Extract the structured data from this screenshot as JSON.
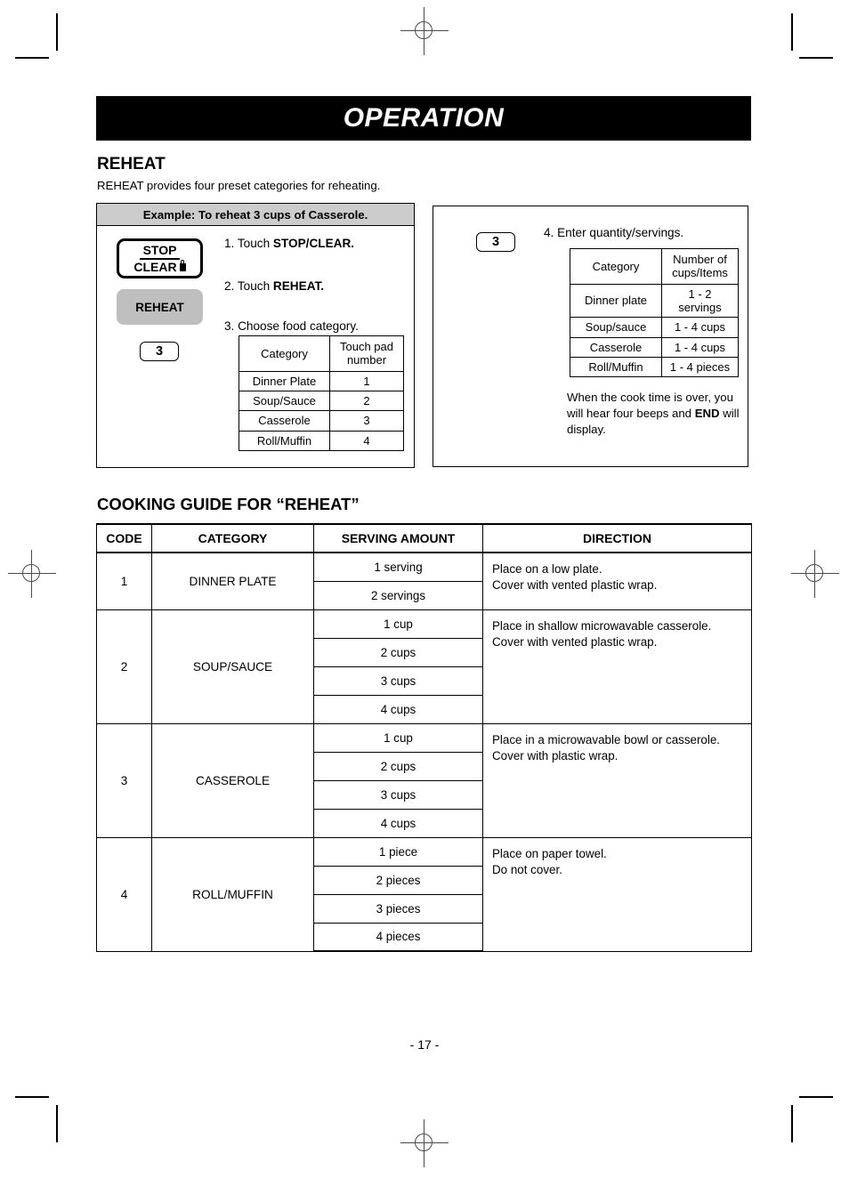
{
  "header": {
    "banner_title": "OPERATION"
  },
  "reheat_section": {
    "title": "REHEAT",
    "description": "REHEAT provides four preset categories for reheating."
  },
  "example_left": {
    "banner": "Example: To reheat 3 cups of Casserole.",
    "keypads": {
      "stop_label": "STOP",
      "clear_label": "CLEAR",
      "lock_icon": "lock-icon",
      "reheat_label": "REHEAT",
      "number_pad": "3"
    },
    "steps": {
      "step1_prefix": "1. Touch ",
      "step1_bold": "STOP/CLEAR.",
      "step2_prefix": "2. Touch ",
      "step2_bold": "REHEAT.",
      "step3": "3. Choose food category."
    },
    "table": {
      "headers": [
        "Category",
        "Touch pad number"
      ],
      "header_col2_line1": "Touch pad",
      "header_col2_line2": "number",
      "rows": [
        [
          "Dinner Plate",
          "1"
        ],
        [
          "Soup/Sauce",
          "2"
        ],
        [
          "Casserole",
          "3"
        ],
        [
          "Roll/Muffin",
          "4"
        ]
      ]
    }
  },
  "example_right": {
    "number_pad": "3",
    "step4": "4. Enter quantity/servings.",
    "table": {
      "header_col1": "Category",
      "header_col2_line1": "Number of",
      "header_col2_line2": "cups/Items",
      "rows": [
        [
          "Dinner plate",
          "1 - 2 servings"
        ],
        [
          "Soup/sauce",
          "1 - 4 cups"
        ],
        [
          "Casserole",
          "1 - 4 cups"
        ],
        [
          "Roll/Muffin",
          "1 - 4 pieces"
        ]
      ]
    },
    "note": {
      "line1": "When the cook time is over,",
      "line2": "you will hear four beeps and",
      "bold_word": "END",
      "line3_rest": " will display."
    }
  },
  "cooking_guide": {
    "title": "COOKING GUIDE FOR “REHEAT”",
    "columns": [
      "CODE",
      "CATEGORY",
      "SERVING AMOUNT",
      "DIRECTION"
    ],
    "groups": [
      {
        "code": "1",
        "category": "DINNER PLATE",
        "amounts": [
          "1 serving",
          "2 servings"
        ],
        "direction": [
          "Place on a low plate.",
          "Cover with vented plastic wrap."
        ]
      },
      {
        "code": "2",
        "category": "SOUP/SAUCE",
        "amounts": [
          "1 cup",
          "2 cups",
          "3 cups",
          "4 cups"
        ],
        "direction": [
          "Place in shallow microwavable casserole.",
          "Cover with vented plastic wrap."
        ]
      },
      {
        "code": "3",
        "category": "CASSEROLE",
        "amounts": [
          "1 cup",
          "2 cups",
          "3 cups",
          "4 cups"
        ],
        "direction": [
          "Place in a microwavable bowl or casserole.",
          "Cover with plastic wrap."
        ]
      },
      {
        "code": "4",
        "category": "ROLL/MUFFIN",
        "amounts": [
          "1 piece",
          "2 pieces",
          "3 pieces",
          "4 pieces"
        ],
        "direction": [
          "Place on paper towel.",
          "Do not cover."
        ]
      }
    ]
  },
  "footer": {
    "page_number": "- 17 -"
  }
}
